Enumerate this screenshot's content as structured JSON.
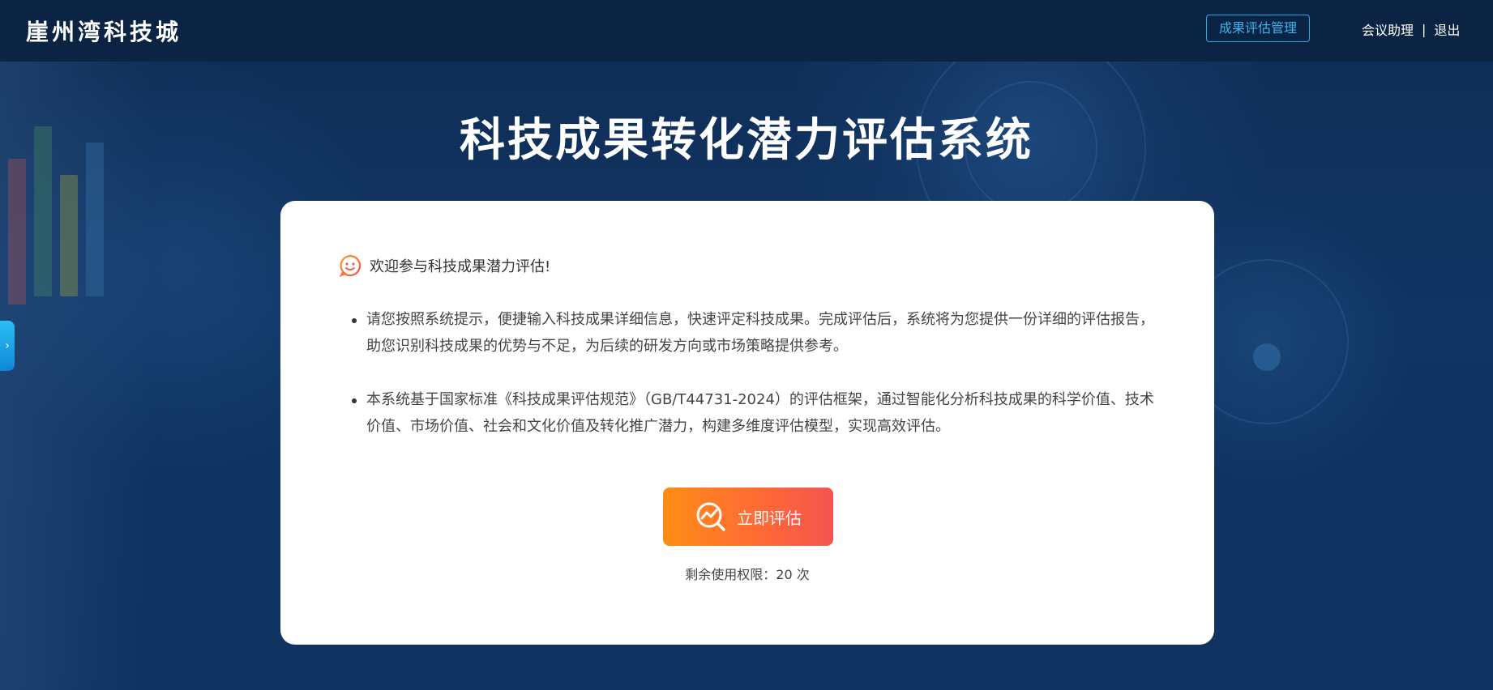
{
  "header": {
    "brand": "崖州湾科技城",
    "manage_button": "成果评估管理",
    "assistant_link": "会议助理",
    "separator": "|",
    "logout_link": "退出"
  },
  "page": {
    "title": "科技成果转化潜力评估系统"
  },
  "side_tab": {
    "glyph": "›"
  },
  "card": {
    "welcome": "欢迎参与科技成果潜力评估!",
    "bullets": [
      "请您按照系统提示，便捷输入科技成果详细信息，快速评定科技成果。完成评估后，系统将为您提供一份详细的评估报告，助您识别科技成果的优势与不足，为后续的研发方向或市场策略提供参考。",
      "本系统基于国家标准《科技成果评估规范》（GB/T44731-2024）的评估框架，通过智能化分析科技成果的科学价值、技术价值、市场价值、社会和文化价值及转化推广潜力，构建多维度评估模型，实现高效评估。"
    ],
    "cta_label": "立即评估",
    "quota_text": "剩余使用权限：20 次"
  },
  "icons": {
    "welcome": "smile-chat-icon",
    "cta": "chart-search-icon",
    "side_tab": "chevron-right-icon"
  },
  "colors": {
    "background": "#0d2a52",
    "header": "#0c2444",
    "accent_blue": "#2aa7e8",
    "cta_gradient_start": "#ff8d15",
    "cta_gradient_end": "#f5534f"
  }
}
